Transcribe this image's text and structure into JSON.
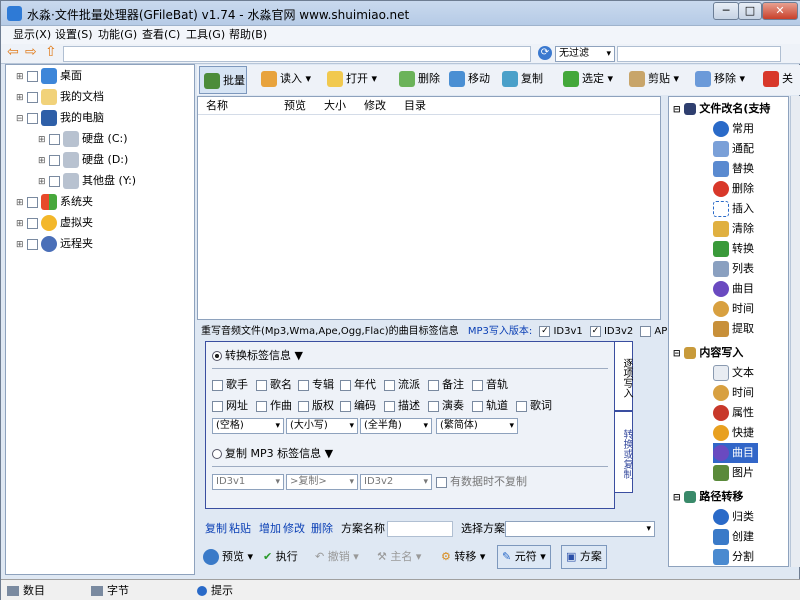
{
  "window": {
    "title": "水淼·文件批量处理器(GFileBat) v1.74 - 水淼官网 www.shuimiao.net",
    "minimize": "─",
    "maximize": "□",
    "close": "✕"
  },
  "menu": [
    "显示(X)",
    "设置(S)",
    "功能(G)",
    "查看(C)",
    "工具(G)",
    "帮助(B)"
  ],
  "filter": {
    "value": "无过滤"
  },
  "tree": [
    {
      "label": "桌面",
      "level": 0
    },
    {
      "label": "我的文档",
      "level": 0
    },
    {
      "label": "我的电脑",
      "level": 0
    },
    {
      "label": "硬盘 (C:)",
      "level": 1
    },
    {
      "label": "硬盘 (D:)",
      "level": 1
    },
    {
      "label": "其他盘 (Y:)",
      "level": 1
    },
    {
      "label": "系统夹",
      "level": 0
    },
    {
      "label": "虚拟夹",
      "level": 0
    },
    {
      "label": "远程夹",
      "level": 0
    }
  ],
  "toolbar": {
    "batch": "批量",
    "read": "读入",
    "open": "打开",
    "delete": "删除",
    "move": "移动",
    "copy": "复制",
    "select": "选定",
    "cut": "剪贴",
    "remove": "移除",
    "close": "关"
  },
  "file_list": {
    "columns": [
      "名称",
      "预览",
      "大小",
      "修改",
      "目录"
    ]
  },
  "audio": {
    "description": "重写音频文件(Mp3,Wma,Ape,Ogg,Flac)的曲目标签信息",
    "version_label": "MP3写入版本:",
    "versions": [
      {
        "label": "ID3v1",
        "checked": true
      },
      {
        "label": "ID3v2",
        "checked": true
      },
      {
        "label": "APEv2",
        "checked": false
      }
    ],
    "convert_title": "转换标签信息 ▼",
    "fields_row1": [
      "歌手",
      "歌名",
      "专辑",
      "年代",
      "流派",
      "备注",
      "音轨"
    ],
    "fields_row2": [
      "网址",
      "作曲",
      "版权",
      "编码",
      "描述",
      "演奏",
      "轨道",
      "歌词"
    ],
    "dropdowns": [
      "(空格)",
      "(大小写)",
      "(全半角)",
      "(繁简体)"
    ],
    "copy_title": "复制 MP3 标签信息 ▼",
    "copy_from": "ID3v1",
    "copy_mode": ">复制>",
    "copy_to": "ID3v2",
    "copy_check": "有数据时不复制",
    "tab_write": "逐项写入",
    "tab_convert": "转换或复制"
  },
  "scheme": {
    "copy": "复制",
    "paste": "粘贴",
    "add": "增加",
    "edit": "修改",
    "delete": "删除",
    "name_label": "方案名称",
    "select_label": "选择方案"
  },
  "actions": {
    "preview": "预览",
    "execute": "执行",
    "undo": "撤销",
    "main": "主名",
    "transfer": "转移",
    "symbol": "元符",
    "scheme": "方案"
  },
  "side": {
    "section1": "文件改名(支持",
    "section1_items": [
      "常用",
      "通配",
      "替换",
      "删除",
      "插入",
      "清除",
      "转换",
      "列表",
      "曲目",
      "时间",
      "提取"
    ],
    "section2": "内容写入",
    "section2_items": [
      "文本",
      "时间",
      "属性",
      "快捷",
      "曲目",
      "图片"
    ],
    "section3": "路径转移",
    "section3_items": [
      "归类",
      "创建",
      "分割"
    ],
    "selected": "曲目"
  },
  "status": {
    "count": "数目",
    "bytes": "字节",
    "hint": "提示"
  },
  "colors": {
    "accent": "#3a6fc4",
    "selected": "#3266c8",
    "link_blue": "#0a3fb5"
  }
}
